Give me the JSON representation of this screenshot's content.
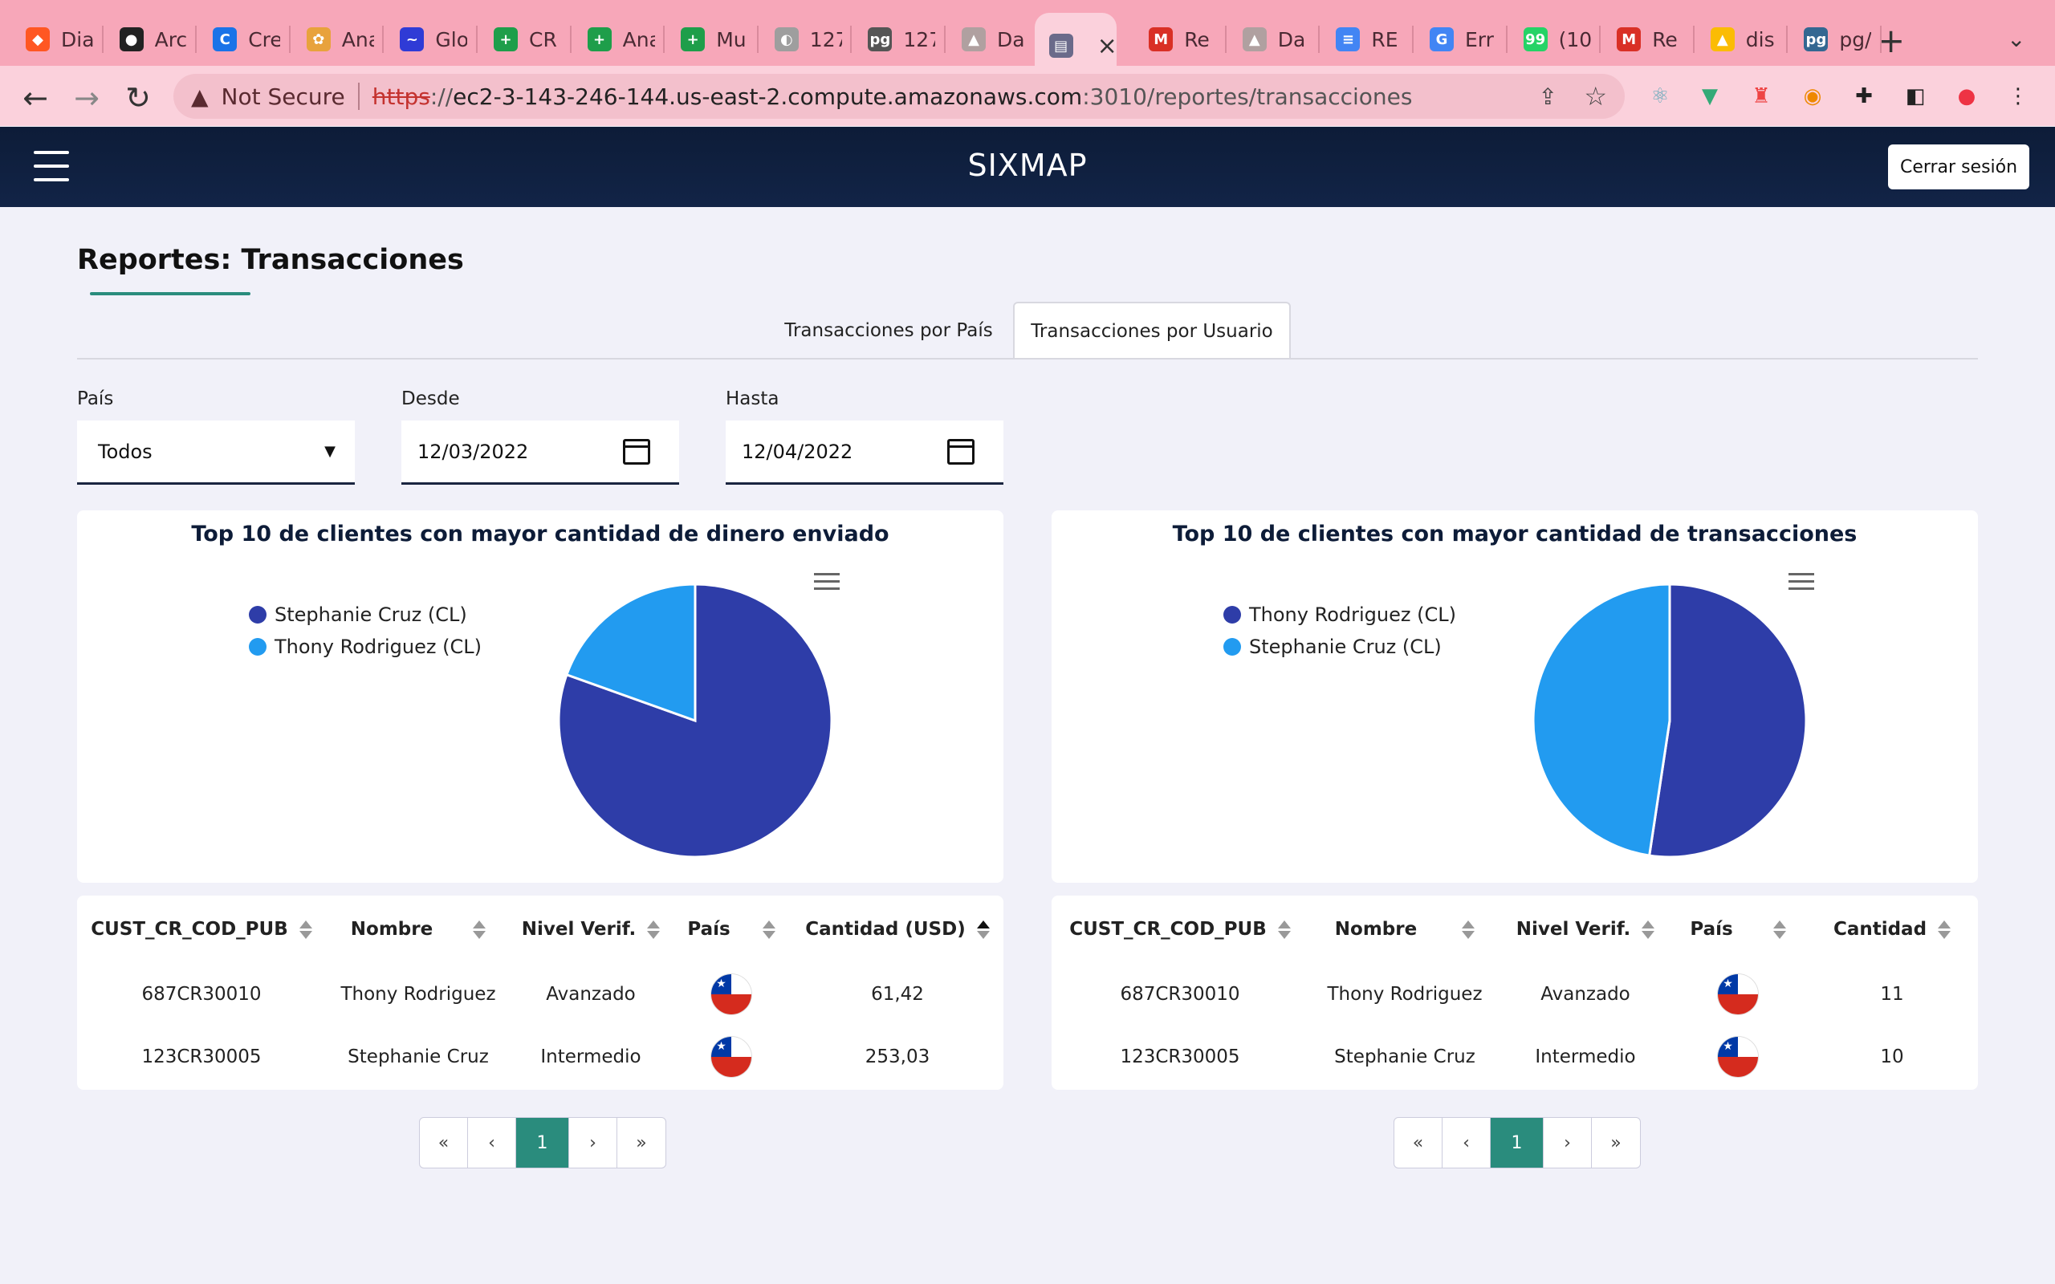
{
  "browser": {
    "tabs": [
      {
        "title": "Dia",
        "color": "#ff5722",
        "glyph": "◆"
      },
      {
        "title": "Arc",
        "color": "#222222",
        "glyph": "●"
      },
      {
        "title": "Cre",
        "color": "#1a73e8",
        "glyph": "C"
      },
      {
        "title": "Ana",
        "color": "#e8a23c",
        "glyph": "✿"
      },
      {
        "title": "Glo",
        "color": "#2f3bd6",
        "glyph": "~"
      },
      {
        "title": "CR",
        "color": "#1e9e4a",
        "glyph": "+"
      },
      {
        "title": "Ana",
        "color": "#1e9e4a",
        "glyph": "+"
      },
      {
        "title": "Mu",
        "color": "#1e9e4a",
        "glyph": "+"
      },
      {
        "title": "127",
        "color": "#9e9e9e",
        "glyph": "◐"
      },
      {
        "title": "127",
        "color": "#555555",
        "glyph": "pg"
      },
      {
        "title": "Da",
        "color": "#b0a0a0",
        "glyph": "▲"
      },
      {
        "title": "",
        "color": "#6a6a8a",
        "glyph": "▤",
        "active": true
      },
      {
        "title": "Re",
        "color": "#d93025",
        "glyph": "M"
      },
      {
        "title": "Da",
        "color": "#b0a0a0",
        "glyph": "▲"
      },
      {
        "title": "RE",
        "color": "#4285f4",
        "glyph": "≡"
      },
      {
        "title": "Err",
        "color": "#4285f4",
        "glyph": "G"
      },
      {
        "title": "(10",
        "color": "#25d366",
        "glyph": "99"
      },
      {
        "title": "Re",
        "color": "#d93025",
        "glyph": "M"
      },
      {
        "title": "dis",
        "color": "#fbbc04",
        "glyph": "▲"
      },
      {
        "title": "pg/",
        "color": "#336791",
        "glyph": "pg"
      }
    ],
    "new_tab": "+",
    "tab_menu": "⌄",
    "security_label": "Not Secure",
    "url_protocol": "https",
    "url_sep": "://",
    "url_host": "ec2-3-143-246-144.us-east-2.compute.amazonaws.com",
    "url_path": ":3010/reportes/transacciones"
  },
  "app": {
    "title": "SIXMAP",
    "logout_label": "Cerrar sesión"
  },
  "page": {
    "title": "Reportes: Transacciones",
    "tabs": [
      "Transacciones por País",
      "Transacciones por Usuario"
    ],
    "active_tab": 1
  },
  "filters": {
    "country_label": "País",
    "country_value": "Todos",
    "from_label": "Desde",
    "from_value": "12/03/2022",
    "to_label": "Hasta",
    "to_value": "12/04/2022"
  },
  "colors": {
    "series_dark": "#2e3da8",
    "series_light": "#229bf0",
    "accent": "#2a8c7d",
    "header": "#0d1c38"
  },
  "chart_data": [
    {
      "type": "pie",
      "title": "Top 10 de clientes con mayor cantidad de dinero enviado",
      "labels": [
        "Stephanie Cruz (CL)",
        "Thony Rodriguez (CL)"
      ],
      "values": [
        253.03,
        61.42
      ],
      "colors": [
        "#2e3da8",
        "#229bf0"
      ],
      "legend": "top-left"
    },
    {
      "type": "pie",
      "title": "Top 10 de clientes con mayor cantidad de transacciones",
      "labels": [
        "Thony Rodriguez (CL)",
        "Stephanie Cruz (CL)"
      ],
      "values": [
        11,
        10
      ],
      "colors": [
        "#2e3da8",
        "#229bf0"
      ],
      "legend": "top-left"
    }
  ],
  "table_left": {
    "headers": [
      "CUST_CR_COD_PUB",
      "Nombre",
      "Nivel Verif.",
      "País",
      "Cantidad (USD)"
    ],
    "rows": [
      [
        "687CR30010",
        "Thony Rodriguez",
        "Avanzado",
        "CL",
        "61,42"
      ],
      [
        "123CR30005",
        "Stephanie Cruz",
        "Intermedio",
        "CL",
        "253,03"
      ]
    ]
  },
  "table_right": {
    "headers": [
      "CUST_CR_COD_PUB",
      "Nombre",
      "Nivel Verif.",
      "País",
      "Cantidad"
    ],
    "rows": [
      [
        "687CR30010",
        "Thony Rodriguez",
        "Avanzado",
        "CL",
        "11"
      ],
      [
        "123CR30005",
        "Stephanie Cruz",
        "Intermedio",
        "CL",
        "10"
      ]
    ]
  },
  "pagination": {
    "first": "«",
    "prev": "‹",
    "current": "1",
    "next": "›",
    "last": "»"
  }
}
